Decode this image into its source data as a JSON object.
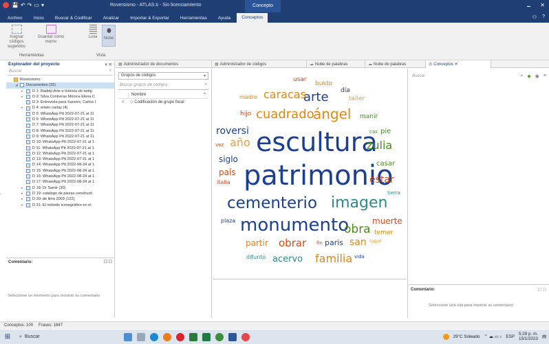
{
  "window": {
    "title": "Roversismo - ATLAS.ti - Sin licenciamiento",
    "context_tab": "Concepto",
    "quick_access": [
      "💾",
      "↶",
      "↷",
      "▭",
      "▾"
    ],
    "controls": [
      "🗕",
      "✕"
    ],
    "top_right": [
      "⚇",
      "?"
    ]
  },
  "menu_tabs": [
    "Archivo",
    "Inicio",
    "Buscar & Codificar",
    "Analizar",
    "Importar & Exportar",
    "Herramientas",
    "Ayuda",
    "Conceptos"
  ],
  "ribbon": {
    "buttons": [
      {
        "label": "Asignar códigos sugeridos",
        "icon": "tag-suggest-icon"
      },
      {
        "label": "Guardar como memo",
        "icon": "memo-icon"
      },
      {
        "label": "Lista",
        "icon": "list-icon"
      },
      {
        "label": "Nube",
        "icon": "cloud-icon"
      }
    ],
    "groups": [
      "Herramientas",
      "Vista"
    ]
  },
  "explorer": {
    "title": "Explorador del proyecto",
    "search_placeholder": "Buscar",
    "items": [
      {
        "label": "Roversismo",
        "indent": 0,
        "icon": "project"
      },
      {
        "label": "Documentos (32)",
        "indent": 1,
        "icon": "folder",
        "selected": true
      },
      {
        "label": "D 1: Radeljr,Arte e historia de antig",
        "indent": 2
      },
      {
        "label": "D 2: Silva Contreras Mónica Elena C",
        "indent": 2
      },
      {
        "label": "D 3: Entrevista para Saveiro, Carlos I",
        "indent": 2
      },
      {
        "label": "D 4: oriwin carlay (4)",
        "indent": 2
      },
      {
        "label": "D 5: WhatsApp Ptt 2022-07-21 at 11",
        "indent": 2
      },
      {
        "label": "D 6: WhatsApp Ptt 2022-07-21 at 11",
        "indent": 2
      },
      {
        "label": "D 7: WhatsApp Ptt 2022-07-21 at 11",
        "indent": 2
      },
      {
        "label": "D 8: WhatsApp Ptt 2022-07-21 at 11",
        "indent": 2
      },
      {
        "label": "D 9: WhatsApp Ptt 2022-07-21 at 11",
        "indent": 2
      },
      {
        "label": "D 10: WhatsApp Ptt 2022-07-21 at 1",
        "indent": 2
      },
      {
        "label": "D 11: WhatsApp Ptt 2022-07-21 at 1",
        "indent": 2
      },
      {
        "label": "D 12: WhatsApp Ptt 2022-07-21 at 1",
        "indent": 2
      },
      {
        "label": "D 13: WhatsApp Ptt 2022-07-21 at 1",
        "indent": 2
      },
      {
        "label": "D 14: WhatsApp Ptt 2022-08-24 at 1",
        "indent": 2
      },
      {
        "label": "D 15: WhatsApp Ptt 2022-08-24 at 1",
        "indent": 2
      },
      {
        "label": "D 16: WhatsApp Ptt 2022-08-24 at 1",
        "indent": 2
      },
      {
        "label": "D 17: WhatsApp Ptt 2022-08-24 at 1",
        "indent": 2
      },
      {
        "label": "D 18: Dr Samir (30)",
        "indent": 2
      },
      {
        "label": "D 19: catalogo de piezas constructi",
        "indent": 2
      },
      {
        "label": "D 20: de lima 2003 (122)",
        "indent": 2
      },
      {
        "label": "D 21: El método iconográfico en el",
        "indent": 2
      }
    ],
    "comment_label": "Comentario:",
    "comment_msg": "Seleccione un elemento para mostrar su comentario"
  },
  "doc_tabs": [
    {
      "label": "Administrador de documentos",
      "active": false
    },
    {
      "label": "Administrador de códigos",
      "active": false
    },
    {
      "label": "Nube de palabras",
      "active": false
    },
    {
      "label": "Nube de palabras",
      "active": false
    },
    {
      "label": "Conceptos ✕",
      "active": true
    }
  ],
  "code_groups": {
    "dropdown": "Grupos de códigos",
    "search_placeholder": "Buscar grupos de códigos",
    "column": "Nombre",
    "rows": [
      {
        "check": "✓",
        "label": "Codificación de grupo focal"
      }
    ]
  },
  "word_cloud": [
    {
      "t": "usar",
      "c": "#d9480f",
      "s": 9
    },
    {
      "t": "busto",
      "c": "#e8860c",
      "s": 9
    },
    {
      "t": "día",
      "c": "#1f3e73",
      "s": 9
    },
    {
      "t": "madre",
      "c": "#e8860c",
      "s": 8
    },
    {
      "t": "caracas",
      "c": "#e8860c",
      "s": 16
    },
    {
      "t": "arte",
      "c": "#1a3f93",
      "s": 18
    },
    {
      "t": "taller",
      "c": "#e8a23c",
      "s": 9
    },
    {
      "t": "hijo",
      "c": "#d9480f",
      "s": 9
    },
    {
      "t": "cuadrado",
      "c": "#e8860c",
      "s": 18
    },
    {
      "t": "ángel",
      "c": "#e8860c",
      "s": 20
    },
    {
      "t": "manir",
      "c": "#4a8a1e",
      "s": 9
    },
    {
      "t": "roversi",
      "c": "#1a3f93",
      "s": 14
    },
    {
      "t": "cas",
      "c": "#4a8a1e",
      "s": 7
    },
    {
      "t": "pie",
      "c": "#4a8a1e",
      "s": 10
    },
    {
      "t": "vez",
      "c": "#d9480f",
      "s": 7
    },
    {
      "t": "año",
      "c": "#e8a23c",
      "s": 16
    },
    {
      "t": "escultura",
      "c": "#1a3f93",
      "s": 38
    },
    {
      "t": "zulia",
      "c": "#4a8a1e",
      "s": 16
    },
    {
      "t": "siglo",
      "c": "#1a3f93",
      "s": 12
    },
    {
      "t": "casar",
      "c": "#4a8a1e",
      "s": 10
    },
    {
      "t": "país",
      "c": "#d9480f",
      "s": 12
    },
    {
      "t": "patrimonio",
      "c": "#1a3f93",
      "s": 40
    },
    {
      "t": "estar",
      "c": "#d9480f",
      "s": 14
    },
    {
      "t": "italia",
      "c": "#d9480f",
      "s": 8
    },
    {
      "t": "tierra",
      "c": "#2a8b8b",
      "s": 7
    },
    {
      "t": "cementerio",
      "c": "#1a3f93",
      "s": 23
    },
    {
      "t": "imagen",
      "c": "#2a8b8b",
      "s": 22
    },
    {
      "t": "plaza",
      "c": "#1a3f93",
      "s": 8
    },
    {
      "t": "monumento",
      "c": "#1a3f93",
      "s": 26
    },
    {
      "t": "muerte",
      "c": "#d9480f",
      "s": 12
    },
    {
      "t": "obra",
      "c": "#4a8a1e",
      "s": 17
    },
    {
      "t": "temer",
      "c": "#e8860c",
      "s": 9
    },
    {
      "t": "partir",
      "c": "#e8860c",
      "s": 12
    },
    {
      "t": "obrar",
      "c": "#d9480f",
      "s": 15
    },
    {
      "t": "fin",
      "c": "#d9480f",
      "s": 7
    },
    {
      "t": "paris",
      "c": "#1a3f93",
      "s": 11
    },
    {
      "t": "san",
      "c": "#e8860c",
      "s": 14
    },
    {
      "t": "lugar",
      "c": "#e8a23c",
      "s": 7
    },
    {
      "t": "difunto",
      "c": "#2a8b8b",
      "s": 8
    },
    {
      "t": "acervo",
      "c": "#2a8b8b",
      "s": 13
    },
    {
      "t": "familia",
      "c": "#e8860c",
      "s": 16
    },
    {
      "t": "vida",
      "c": "#1a3f93",
      "s": 7
    }
  ],
  "right_panel": {
    "search_placeholder": "Buscar",
    "comment_label": "Comentario:",
    "comment_msg": "Seleccione una cita para mostrar su comentario"
  },
  "status": {
    "concepts": "Conceptos: 100",
    "phrases": "Frases: 1847"
  },
  "taskbar": {
    "search": "Buscar",
    "weather": "29°C Soleado",
    "lang": "ESP",
    "time": "5:29 p. m.",
    "date": "15/1/2023"
  }
}
